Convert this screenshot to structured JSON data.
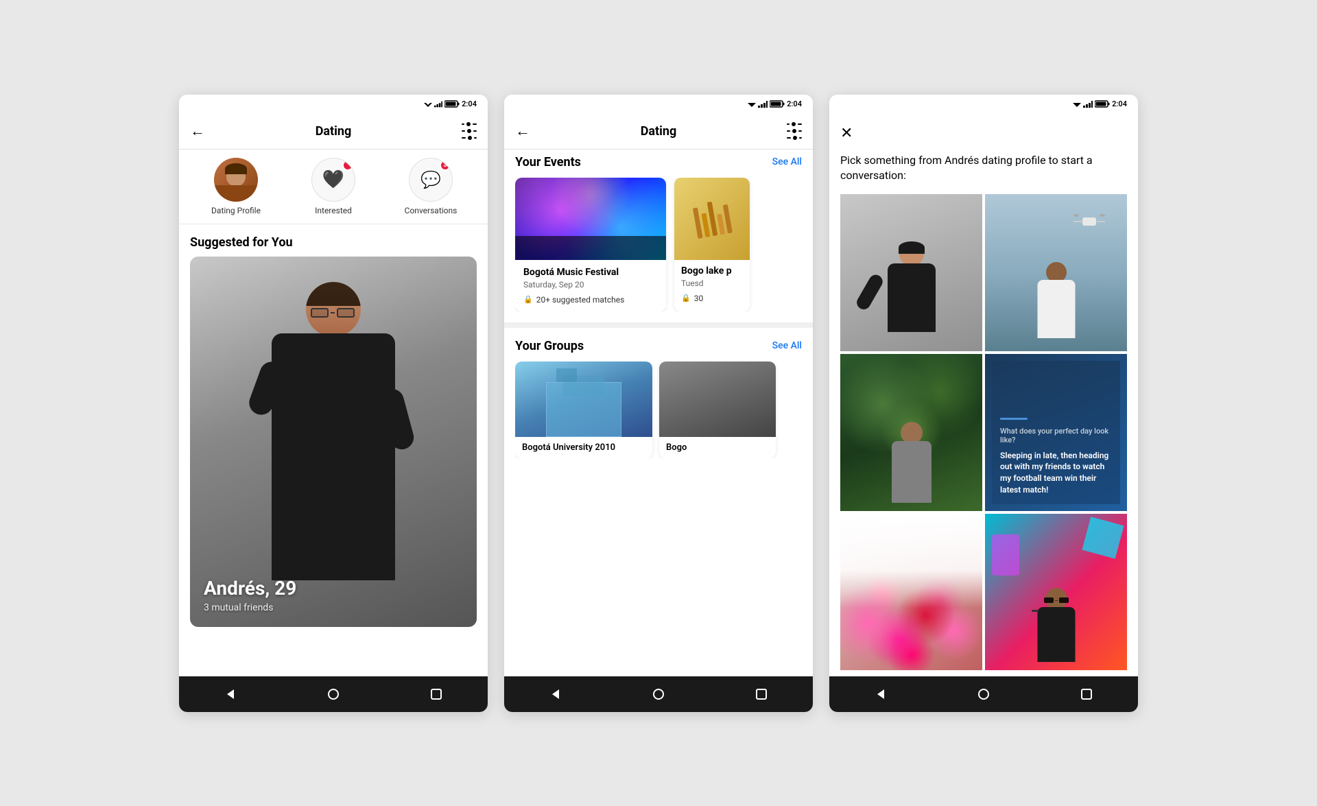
{
  "phone1": {
    "statusBar": {
      "time": "2:04"
    },
    "nav": {
      "title": "Dating",
      "back": "←"
    },
    "quickActions": [
      {
        "id": "profile",
        "label": "Dating Profile",
        "iconType": "avatar"
      },
      {
        "id": "interested",
        "label": "Interested",
        "iconType": "heart",
        "badge": ""
      },
      {
        "id": "conversations",
        "label": "Conversations",
        "iconType": "chat",
        "badge": "3"
      }
    ],
    "sectionTitle": "Suggested for You",
    "profileCard": {
      "name": "Andrés, 29",
      "mutualFriends": "3 mutual friends"
    },
    "bottomNav": [
      "◁",
      "○",
      "□"
    ]
  },
  "phone2": {
    "statusBar": {
      "time": "2:04"
    },
    "nav": {
      "title": "Dating",
      "back": "←"
    },
    "events": {
      "title": "Your Events",
      "seeAll": "See All",
      "items": [
        {
          "title": "Bogotá Music Festival",
          "date": "Saturday, Sep 20",
          "matches": "20+ suggested matches"
        },
        {
          "title": "Bogo lake p",
          "date": "Tuesd",
          "matches": "30"
        }
      ]
    },
    "groups": {
      "title": "Your Groups",
      "seeAll": "See All",
      "items": [
        {
          "label": "Bogotá University 2010"
        },
        {
          "label": "Bogo"
        }
      ]
    },
    "bottomNav": [
      "◁",
      "○",
      "□"
    ]
  },
  "phone3": {
    "statusBar": {
      "time": "2:04"
    },
    "closeBtn": "✕",
    "prompt": "Pick something from Andrés dating profile to start a conversation:",
    "gridItems": [
      {
        "type": "photo",
        "desc": "person sitting"
      },
      {
        "type": "photo",
        "desc": "person with drone outdoor"
      },
      {
        "type": "photo",
        "desc": "person in greenery"
      },
      {
        "type": "text",
        "question": "What does your perfect day look like?",
        "answer": "Sleeping in late, then heading out with my friends to watch my football team win their latest match!"
      },
      {
        "type": "photo",
        "desc": "flowers"
      },
      {
        "type": "photo",
        "desc": "person with sunglasses colorful bg"
      }
    ],
    "bottomNav": [
      "◁",
      "○",
      "□"
    ]
  }
}
